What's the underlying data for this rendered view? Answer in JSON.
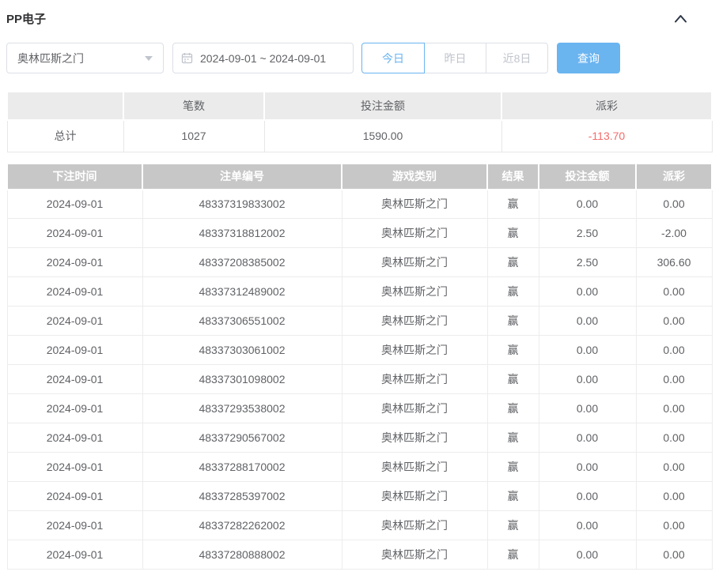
{
  "panel": {
    "title": "PP电子",
    "collapse_icon": "chevron-up"
  },
  "filters": {
    "game_select": {
      "value": "奥林匹斯之门"
    },
    "date_range": {
      "value": "2024-09-01 ~ 2024-09-01",
      "icon": "calendar"
    },
    "quick_buttons": [
      {
        "label": "今日",
        "active": true
      },
      {
        "label": "昨日",
        "active": false
      },
      {
        "label": "近8日",
        "active": false
      }
    ],
    "query_button_label": "查询"
  },
  "summary": {
    "headers": [
      "",
      "笔数",
      "投注金额",
      "派彩"
    ],
    "row": {
      "label": "总计",
      "count": "1027",
      "bet_amount": "1590.00",
      "payout": "-113.70"
    }
  },
  "table": {
    "headers": [
      "下注时间",
      "注单编号",
      "游戏类别",
      "结果",
      "投注金额",
      "派彩"
    ],
    "rows": [
      [
        "2024-09-01",
        "48337319833002",
        "奥林匹斯之门",
        "赢",
        "0.00",
        "0.00"
      ],
      [
        "2024-09-01",
        "48337318812002",
        "奥林匹斯之门",
        "赢",
        "2.50",
        "-2.00"
      ],
      [
        "2024-09-01",
        "48337208385002",
        "奥林匹斯之门",
        "赢",
        "2.50",
        "306.60"
      ],
      [
        "2024-09-01",
        "48337312489002",
        "奥林匹斯之门",
        "赢",
        "0.00",
        "0.00"
      ],
      [
        "2024-09-01",
        "48337306551002",
        "奥林匹斯之门",
        "赢",
        "0.00",
        "0.00"
      ],
      [
        "2024-09-01",
        "48337303061002",
        "奥林匹斯之门",
        "赢",
        "0.00",
        "0.00"
      ],
      [
        "2024-09-01",
        "48337301098002",
        "奥林匹斯之门",
        "赢",
        "0.00",
        "0.00"
      ],
      [
        "2024-09-01",
        "48337293538002",
        "奥林匹斯之门",
        "赢",
        "0.00",
        "0.00"
      ],
      [
        "2024-09-01",
        "48337290567002",
        "奥林匹斯之门",
        "赢",
        "0.00",
        "0.00"
      ],
      [
        "2024-09-01",
        "48337288170002",
        "奥林匹斯之门",
        "赢",
        "0.00",
        "0.00"
      ],
      [
        "2024-09-01",
        "48337285397002",
        "奥林匹斯之门",
        "赢",
        "0.00",
        "0.00"
      ],
      [
        "2024-09-01",
        "48337282262002",
        "奥林匹斯之门",
        "赢",
        "0.00",
        "0.00"
      ],
      [
        "2024-09-01",
        "48337280888002",
        "奥林匹斯之门",
        "赢",
        "0.00",
        "0.00"
      ]
    ]
  },
  "colors": {
    "accent_blue": "#6ab4f0",
    "negative_red": "#f56c6c",
    "table_header_bg": "#c7c7c7",
    "summary_header_bg": "#ebebeb"
  }
}
